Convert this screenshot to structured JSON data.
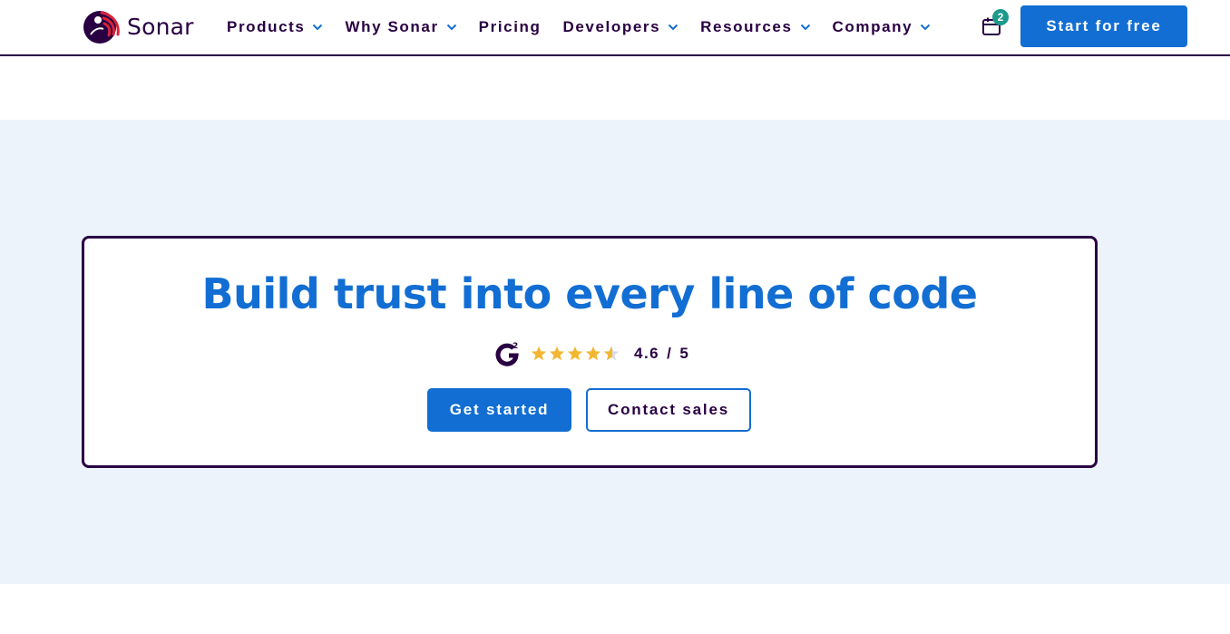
{
  "brand": {
    "name": "Sonar",
    "colors": {
      "primary": "#126ed3",
      "dark": "#290042",
      "hero_bg": "#ecf3fb",
      "badge": "#1d9a8b",
      "star": "#f2b632"
    }
  },
  "header": {
    "nav": [
      {
        "label": "Products",
        "has_dropdown": true
      },
      {
        "label": "Why Sonar",
        "has_dropdown": true
      },
      {
        "label": "Pricing",
        "has_dropdown": false
      },
      {
        "label": "Developers",
        "has_dropdown": true
      },
      {
        "label": "Resources",
        "has_dropdown": true
      },
      {
        "label": "Company",
        "has_dropdown": true
      }
    ],
    "calendar": {
      "icon": "calendar-icon",
      "badge_count": "2"
    },
    "cta_label": "Start for free"
  },
  "hero": {
    "headline": "Build trust into every line of code",
    "rating": {
      "icon": "g2-logo-icon",
      "stars": 4.6,
      "value": "4.6",
      "separator": "/",
      "max": "5"
    },
    "buttons": {
      "primary_label": "Get started",
      "secondary_label": "Contact sales"
    }
  }
}
